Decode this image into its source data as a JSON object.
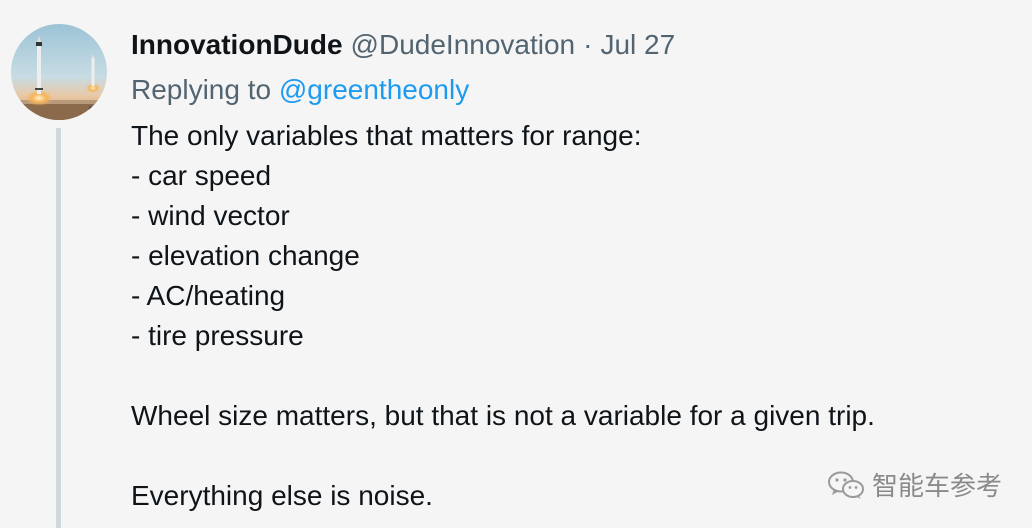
{
  "tweet": {
    "display_name": "InnovationDude",
    "handle": "@DudeInnovation",
    "separator": "·",
    "date": "Jul 27",
    "replying_prefix": "Replying to",
    "replying_to": "@greentheonly",
    "text_lines": [
      "The only variables that matters for range:",
      "- car speed",
      "- wind vector",
      "- elevation change",
      "- AC/heating",
      "- tire pressure"
    ],
    "paragraph_2": "Wheel size matters, but that is not a variable for a given trip.",
    "paragraph_3": "Everything else is noise.",
    "avatar_icon": "rocket-landing-avatar"
  },
  "watermark": {
    "icon": "wechat-icon",
    "text": "智能车参考"
  },
  "colors": {
    "text": "#0f1419",
    "secondary": "#536471",
    "link": "#1d9bf0",
    "thread_line": "#cfd9de",
    "background": "#f5f5f5"
  }
}
